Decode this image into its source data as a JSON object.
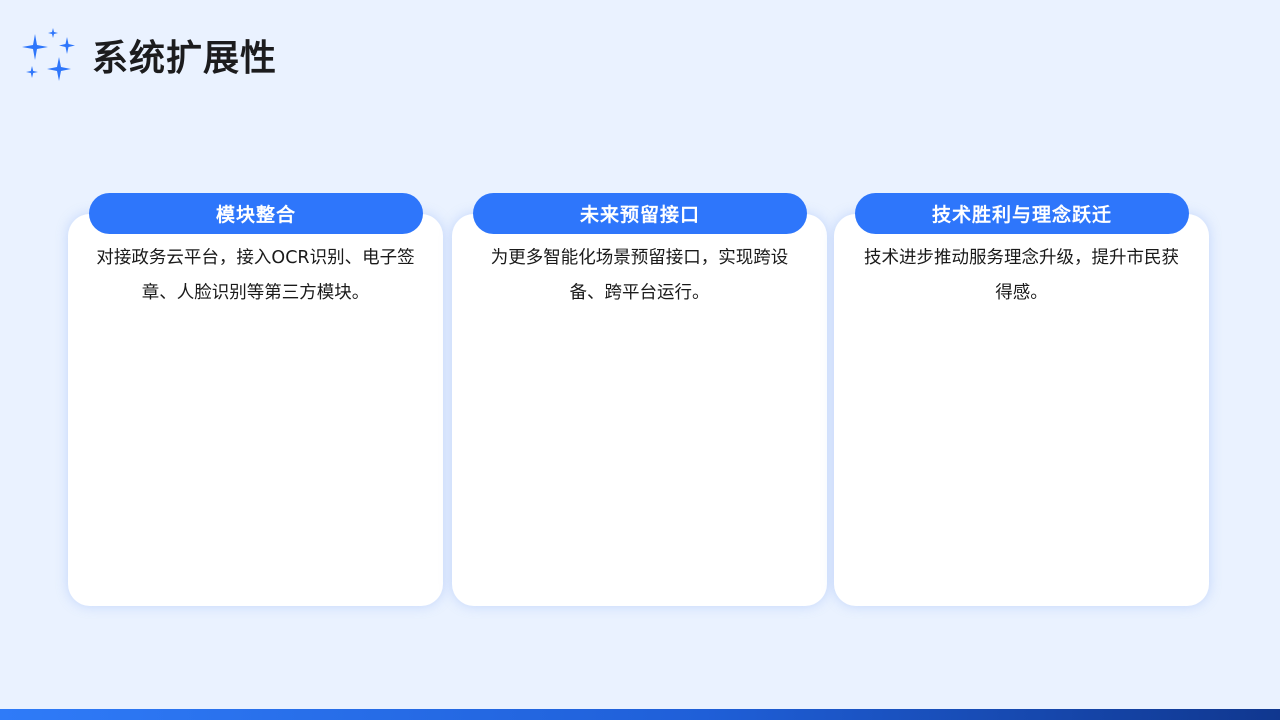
{
  "header": {
    "icon": "sparkle-stars-icon",
    "title": "系统扩展性"
  },
  "colors": {
    "background": "#eaf2ff",
    "accent": "#2e76fb",
    "card": "#ffffff",
    "bottom_bar_start": "#2f7bf8",
    "bottom_bar_end": "#10378f"
  },
  "cards": [
    {
      "label": "模块整合",
      "text": "对接政务云平台，接入OCR识别、电子签章、人脸识别等第三方模块。"
    },
    {
      "label": "未来预留接口",
      "text": "为更多智能化场景预留接口，实现跨设备、跨平台运行。"
    },
    {
      "label": "技术胜利与理念跃迁",
      "text": "技术进步推动服务理念升级，提升市民获得感。"
    }
  ]
}
